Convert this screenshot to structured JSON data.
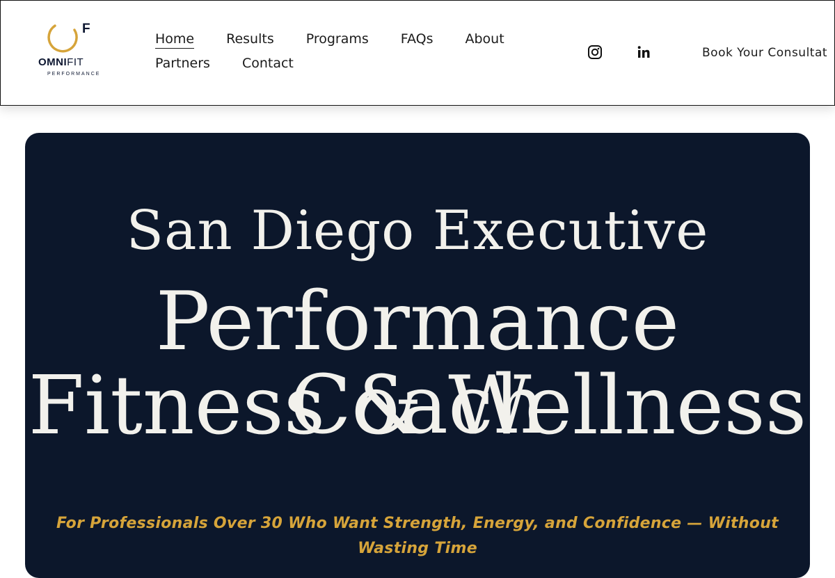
{
  "brand": {
    "name_bold": "OMNI",
    "name_rest": "FIT",
    "sub": "PERFORMANCE",
    "mark": "F",
    "ring_color": "#d6a43a",
    "navy": "#0c1630"
  },
  "nav": {
    "row1": [
      "Home",
      "Results",
      "Programs",
      "FAQs",
      "About"
    ],
    "row2": [
      "Partners",
      "Contact"
    ],
    "active": "Home"
  },
  "social": {
    "instagram": "instagram-icon",
    "linkedin": "linkedin-icon"
  },
  "header_cta": {
    "label": "Book Your Consultat"
  },
  "hero": {
    "line1": "San Diego Executive",
    "line2": "Performance Coach",
    "line3": "Fitness & Wellness",
    "tagline": "For Professionals Over 30 Who Want Strength, Energy, and Confidence — Without Wasting Time",
    "bg_color": "#0c172b",
    "accent_color": "#d6a43a"
  }
}
